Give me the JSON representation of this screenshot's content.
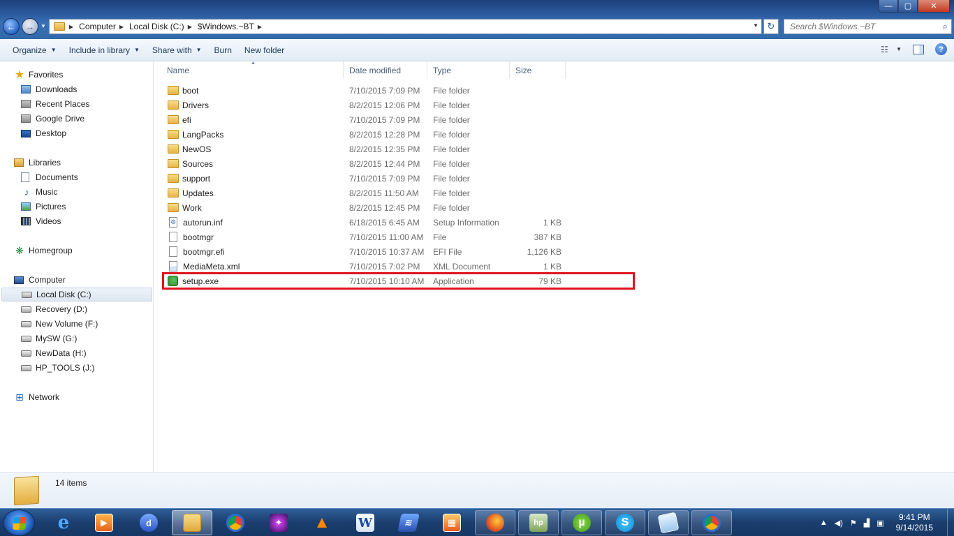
{
  "window": {
    "min_glyph": "—",
    "max_glyph": "▢",
    "close_glyph": "✕"
  },
  "address": {
    "crumbs": [
      "Computer",
      "Local Disk (C:)",
      "$Windows.~BT"
    ],
    "search_placeholder": "Search $Windows.~BT"
  },
  "toolbar": {
    "organize": "Organize",
    "include_in_library": "Include in library",
    "share_with": "Share with",
    "burn": "Burn",
    "new_folder": "New folder"
  },
  "nav": {
    "favorites": "Favorites",
    "favorites_items": [
      "Downloads",
      "Recent Places",
      "Google Drive",
      "Desktop"
    ],
    "libraries": "Libraries",
    "libraries_items": [
      "Documents",
      "Music",
      "Pictures",
      "Videos"
    ],
    "homegroup": "Homegroup",
    "computer": "Computer",
    "computer_items": [
      "Local Disk (C:)",
      "Recovery (D:)",
      "New Volume (F:)",
      "MySW (G:)",
      "NewData (H:)",
      "HP_TOOLS (J:)"
    ],
    "network": "Network"
  },
  "columns": {
    "name": "Name",
    "date_modified": "Date modified",
    "type": "Type",
    "size": "Size"
  },
  "files": [
    {
      "name": "boot",
      "date": "7/10/2015 7:09 PM",
      "type": "File folder",
      "size": "",
      "icon": "folder"
    },
    {
      "name": "Drivers",
      "date": "8/2/2015 12:06 PM",
      "type": "File folder",
      "size": "",
      "icon": "folder"
    },
    {
      "name": "efi",
      "date": "7/10/2015 7:09 PM",
      "type": "File folder",
      "size": "",
      "icon": "folder"
    },
    {
      "name": "LangPacks",
      "date": "8/2/2015 12:28 PM",
      "type": "File folder",
      "size": "",
      "icon": "folder"
    },
    {
      "name": "NewOS",
      "date": "8/2/2015 12:35 PM",
      "type": "File folder",
      "size": "",
      "icon": "folder"
    },
    {
      "name": "Sources",
      "date": "8/2/2015 12:44 PM",
      "type": "File folder",
      "size": "",
      "icon": "folder"
    },
    {
      "name": "support",
      "date": "7/10/2015 7:09 PM",
      "type": "File folder",
      "size": "",
      "icon": "folder"
    },
    {
      "name": "Updates",
      "date": "8/2/2015 11:50 AM",
      "type": "File folder",
      "size": "",
      "icon": "folder"
    },
    {
      "name": "Work",
      "date": "8/2/2015 12:45 PM",
      "type": "File folder",
      "size": "",
      "icon": "folder"
    },
    {
      "name": "autorun.inf",
      "date": "6/18/2015 6:45 AM",
      "type": "Setup Information",
      "size": "1 KB",
      "icon": "inf"
    },
    {
      "name": "bootmgr",
      "date": "7/10/2015 11:00 AM",
      "type": "File",
      "size": "387 KB",
      "icon": "file"
    },
    {
      "name": "bootmgr.efi",
      "date": "7/10/2015 10:37 AM",
      "type": "EFI File",
      "size": "1,126 KB",
      "icon": "file"
    },
    {
      "name": "MediaMeta.xml",
      "date": "7/10/2015 7:02 PM",
      "type": "XML Document",
      "size": "1 KB",
      "icon": "xml"
    },
    {
      "name": "setup.exe",
      "date": "7/10/2015 10:10 AM",
      "type": "Application",
      "size": "79 KB",
      "icon": "exe"
    }
  ],
  "status": {
    "item_count": "14 items"
  },
  "taskbar": {
    "time": "9:41 PM",
    "date": "9/14/2015"
  },
  "colors": {
    "highlight": "#e0141e",
    "title_bar": "#2a5a9e",
    "taskbar": "#1b3e6f"
  }
}
